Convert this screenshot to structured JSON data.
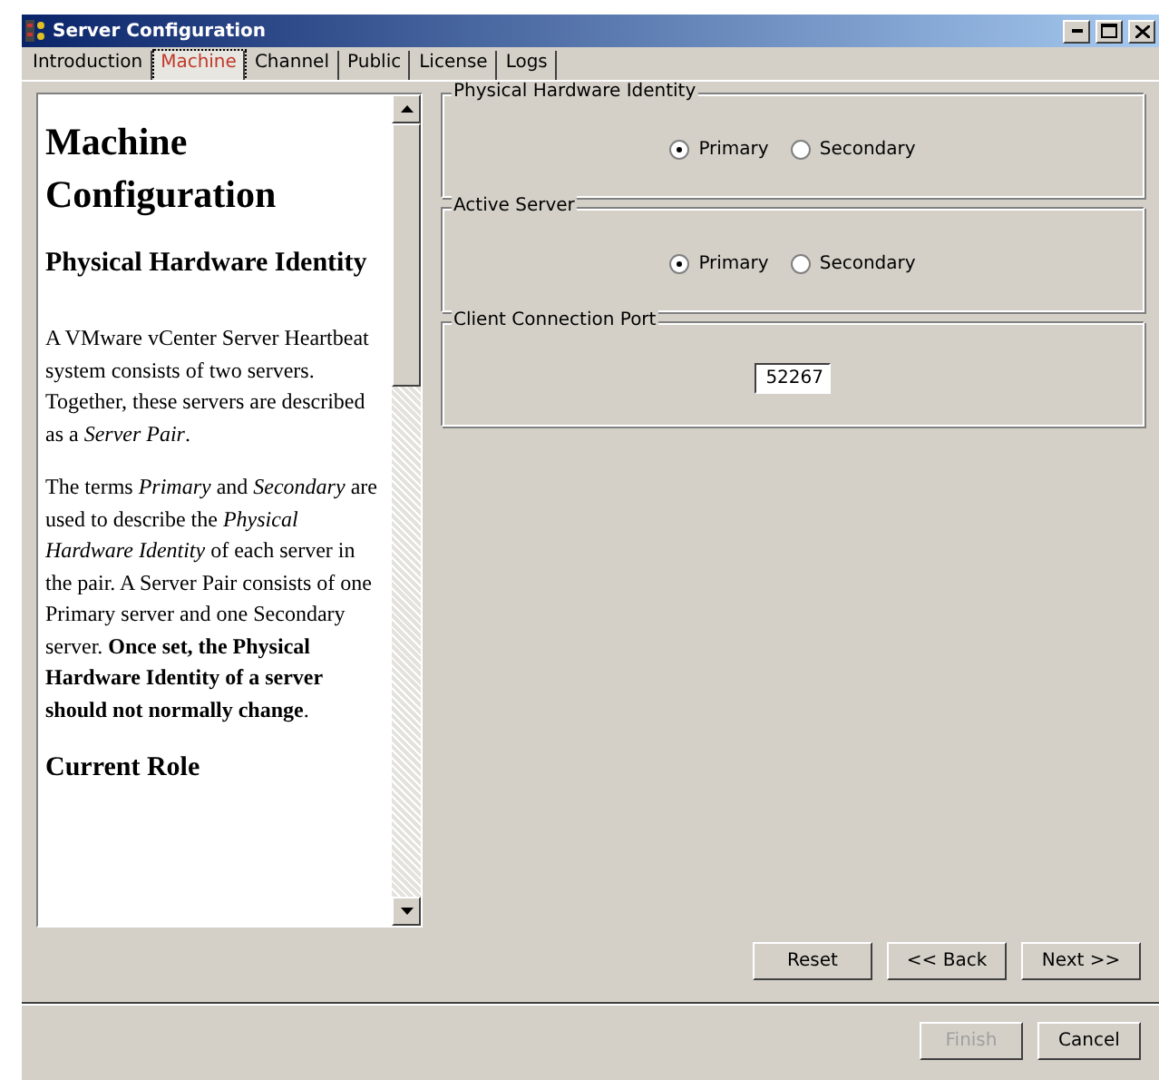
{
  "window": {
    "title": "Server Configuration"
  },
  "tabs": [
    {
      "label": "Introduction",
      "selected": false
    },
    {
      "label": "Machine",
      "selected": true
    },
    {
      "label": "Channel",
      "selected": false
    },
    {
      "label": "Public",
      "selected": false
    },
    {
      "label": "License",
      "selected": false
    },
    {
      "label": "Logs",
      "selected": false
    }
  ],
  "help": [
    {
      "kind": "h1",
      "text": "Machine Configuration"
    },
    {
      "kind": "h2",
      "text": "Physical Hardware Identity"
    },
    {
      "kind": "p",
      "text": "A VMware vCenter Server Heartbeat system consists of two servers. Together, these servers are described as a *Server Pair*."
    },
    {
      "kind": "p",
      "text": "The terms *Primary* and *Secondary* are used to describe the *Physical Hardware Identity* of each server in the pair. A Server Pair consists of one Primary server and one Secondary server. **Once set, the Physical Hardware Identity of a server should not normally change**."
    },
    {
      "kind": "h2",
      "text": "Current Role"
    }
  ],
  "groups": [
    {
      "kind": "radio",
      "title": "Physical Hardware Identity",
      "options": [
        {
          "label": "Primary",
          "selected": true
        },
        {
          "label": "Secondary",
          "selected": false
        }
      ]
    },
    {
      "kind": "radio",
      "title": "Active Server",
      "options": [
        {
          "label": "Primary",
          "selected": true
        },
        {
          "label": "Secondary",
          "selected": false
        }
      ]
    },
    {
      "kind": "input",
      "title": "Client Connection Port",
      "value": "52267"
    }
  ],
  "nav_buttons": [
    {
      "label": "Reset",
      "disabled": false
    },
    {
      "label": "<< Back",
      "disabled": false
    },
    {
      "label": "Next >>",
      "disabled": false
    }
  ],
  "footer_buttons": [
    {
      "label": "Finish",
      "disabled": true
    },
    {
      "label": "Cancel",
      "disabled": false
    }
  ]
}
